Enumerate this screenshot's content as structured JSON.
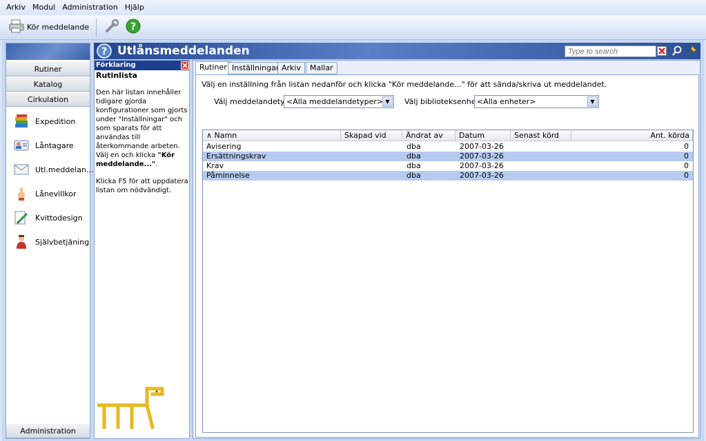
{
  "menu": [
    "Arkiv",
    "Modul",
    "Administration",
    "Hjälp"
  ],
  "toolbar": {
    "run_label": "Kör meddelande"
  },
  "nav": {
    "bars": [
      "Rutiner",
      "Katalog",
      "Cirkulation"
    ],
    "items": [
      "Expedition",
      "Låntagare",
      "Utl.meddelan...",
      "Lånevillkor",
      "Kvittodesign",
      "Självbetjäning"
    ],
    "bottom": "Administration"
  },
  "title": "Utlånsmeddelanden",
  "search": {
    "placeholder": "Type to search"
  },
  "explain": {
    "head": "Förklaring",
    "title": "Rutinlista",
    "p1": "Den här listan innehåller tidigare gjorda konfigurationer som gjorts under \"Inställningar\" och som sparats för att användas till återkommande arbeten. Välj en och klicka",
    "p1_bold": "\"Kör meddelande...\"",
    "p1_end": ".",
    "p2": "Klicka F5 för att uppdatera listan om nödvändigt."
  },
  "tabs": [
    "Rutiner",
    "Inställningar",
    "Arkiv",
    "Mallar"
  ],
  "instruction": "Välj en inställning från listan nedanför och klicka \"Kör meddelande...\" för att sända/skriva ut meddelandet.",
  "filters": {
    "type_label": "Välj meddelandetyp:",
    "type_value": "<Alla meddelandetyper>",
    "unit_label": "Välj biblioteksenhet:",
    "unit_value": "<Alla enheter>"
  },
  "table": {
    "headers": [
      "∧ Namn",
      "Skapad vid",
      "Ändrat av",
      "Datum",
      "Senast körd",
      "Ant. körda"
    ],
    "rows": [
      [
        "Avisering",
        "",
        "dba",
        "2007-03-26",
        "",
        "0"
      ],
      [
        "Ersättningskrav",
        "",
        "dba",
        "2007-03-26",
        "",
        "0"
      ],
      [
        "Krav",
        "",
        "dba",
        "2007-03-26",
        "",
        "0"
      ],
      [
        "Påminnelse",
        "",
        "dba",
        "2007-03-26",
        "",
        "0"
      ]
    ]
  }
}
